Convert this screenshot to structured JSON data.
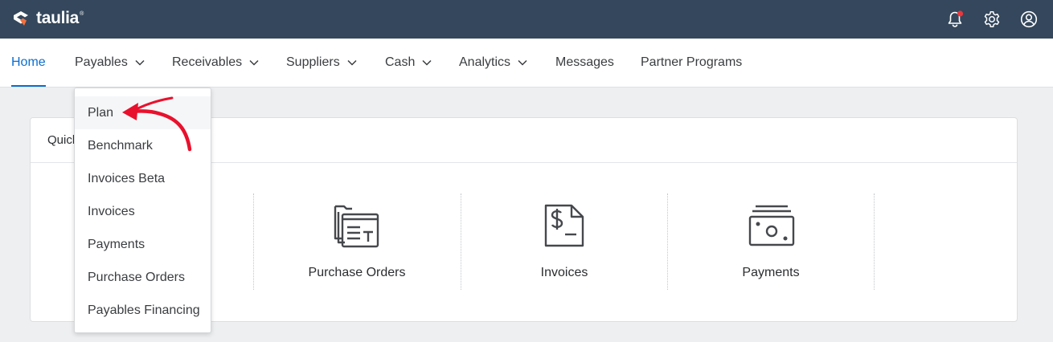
{
  "brand": {
    "name": "taulia",
    "tm": "®"
  },
  "topbar": {
    "icons": [
      "bell-icon",
      "gear-icon",
      "user-icon"
    ],
    "notification_color": "#e8383d"
  },
  "nav": {
    "items": [
      {
        "label": "Home",
        "active": true,
        "has_menu": false
      },
      {
        "label": "Payables",
        "active": false,
        "has_menu": true
      },
      {
        "label": "Receivables",
        "active": false,
        "has_menu": true
      },
      {
        "label": "Suppliers",
        "active": false,
        "has_menu": true
      },
      {
        "label": "Cash",
        "active": false,
        "has_menu": true
      },
      {
        "label": "Analytics",
        "active": false,
        "has_menu": true
      },
      {
        "label": "Messages",
        "active": false,
        "has_menu": false
      },
      {
        "label": "Partner Programs",
        "active": false,
        "has_menu": false
      }
    ]
  },
  "payables_menu": {
    "items": [
      "Plan",
      "Benchmark",
      "Invoices Beta",
      "Invoices",
      "Payments",
      "Purchase Orders",
      "Payables Financing"
    ]
  },
  "quick_card": {
    "title": "Quick",
    "tiles": [
      {
        "label": "Purchase Orders",
        "icon": "purchase-orders-icon"
      },
      {
        "label": "Invoices",
        "icon": "invoice-icon"
      },
      {
        "label": "Payments",
        "icon": "payments-icon"
      }
    ]
  },
  "colors": {
    "topbar": "#34475c",
    "accent": "#0a6ed1",
    "annotation_arrow": "#e8112d"
  }
}
